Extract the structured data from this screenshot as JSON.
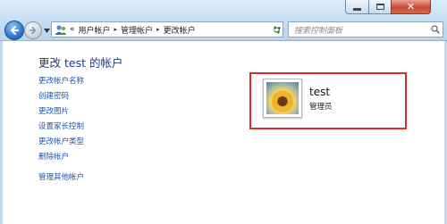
{
  "window": {
    "minimize_label": "—",
    "maximize_label": "□",
    "close_label": "✕"
  },
  "nav": {
    "back_icon": "back-arrow-icon",
    "forward_icon": "forward-arrow-icon"
  },
  "address": {
    "overflow": "«",
    "crumbs": [
      "用户帐户",
      "管理帐户",
      "更改帐户"
    ],
    "separator": "▸",
    "dropdown": "▾"
  },
  "search": {
    "placeholder": "搜索控制面板"
  },
  "page": {
    "title": "更改 test 的帐户",
    "links": [
      "更改帐户名称",
      "创建密码",
      "更改图片",
      "设置家长控制",
      "更改帐户类型",
      "删除帐户"
    ],
    "other_link": "管理其他帐户"
  },
  "account": {
    "name": "test",
    "role": "管理员",
    "highlight_color": "#e02828"
  },
  "colors": {
    "link": "#1f56a8",
    "title": "#1e3c8c",
    "chrome": "#c4dcf1"
  }
}
